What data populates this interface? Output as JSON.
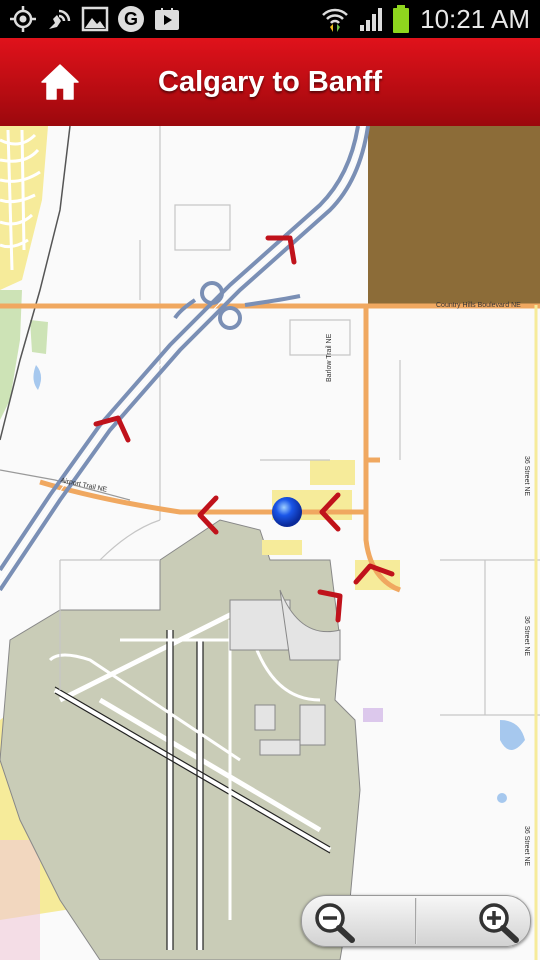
{
  "status_bar": {
    "time": "10:21 AM",
    "icons": [
      "gps-icon",
      "wifi-calling-icon",
      "gallery-icon",
      "google-icon",
      "play-store-icon",
      "wifi-icon",
      "signal-icon",
      "battery-icon"
    ]
  },
  "header": {
    "title": "Calgary to Banff",
    "home_icon": "home-icon"
  },
  "map": {
    "road_labels": {
      "country_hills": "Country Hills Boulevard NE",
      "barlow": "Barlow Trail NE",
      "airport_trail": "Airport Trail NE",
      "street_36_a": "36 Street NE",
      "street_36_b": "36 Street NE",
      "street_36_c": "36 Street NE"
    },
    "route_arrows": 5,
    "current_location": "blue-location-dot"
  },
  "zoom_controls": {
    "zoom_out_icon": "zoom-out-icon",
    "zoom_in_icon": "zoom-in-icon"
  },
  "colors": {
    "header_red": "#c70f16",
    "highway": "#7a8fb5",
    "arterial": "#f0a860",
    "route_arrow": "#c0121b",
    "location_dot": "#1a56e8",
    "airport_area": "#c9ccb7",
    "brown_area": "#8c6c38",
    "yellow_area": "#f6eb9a"
  }
}
